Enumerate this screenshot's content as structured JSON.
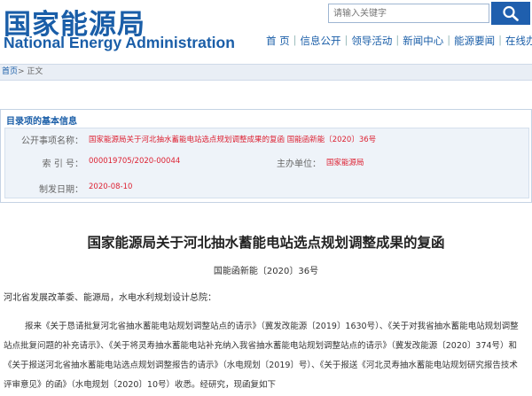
{
  "header": {
    "logo_cn": "国家能源局",
    "logo_en": "National Energy Administration"
  },
  "search": {
    "placeholder": "请输入关键字",
    "icon": "search-icon"
  },
  "nav": {
    "items": [
      "首 页",
      "信息公开",
      "领导活动",
      "新闻中心",
      "能源要闻",
      "在线办事"
    ]
  },
  "breadcrumb": {
    "home": "首页",
    "separator": "> ",
    "current": "正文"
  },
  "info_panel": {
    "title": "目录项的基本信息",
    "labels": {
      "title": "公开事项名称：",
      "index": "索 引 号：",
      "org": "主办单位：",
      "date": "制发日期："
    },
    "values": {
      "title": "国家能源局关于河北抽水蓄能电站选点规划调整成果的复函  国能函新能〔2020〕36号",
      "index": "000019705/2020-00044",
      "org": "国家能源局",
      "date": "2020-08-10"
    }
  },
  "document": {
    "title": "国家能源局关于河北抽水蓄能电站选点规划调整成果的复函",
    "number": "国能函新能〔2020〕36号",
    "addressee": "河北省发展改革委、能源局，水电水利规划设计总院：",
    "body": "报来《关于恳请批复河北省抽水蓄能电站规划调整站点的请示》（冀发改能源〔2019〕1630号）、《关于对我省抽水蓄能电站规划调整站点批复问题的补充请示》、《关于将灵寿抽水蓄能电站补充纳入我省抽水蓄能电站规划调整站点的请示》（冀发改能源〔2020〕374号）和《关于报送河北省抽水蓄能电站选点规划调整报告的请示》（水电规划〔2019〕号）、《关于报送《河北灵寿抽水蓄能电站规划研究报告技术评审意见》的函》（水电规划〔2020〕10号）收悉。经研究，现函复如下"
  },
  "colors": {
    "brand": "#1a5ea8",
    "search_button": "#1f5fae",
    "info_value": "#d23"
  }
}
